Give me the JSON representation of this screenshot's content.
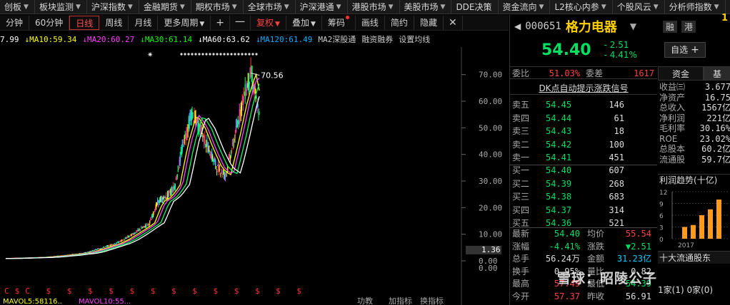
{
  "menu": [
    "创板",
    "板块监测",
    "沪深指数",
    "金融期货",
    "期权市场",
    "全球市场",
    "沪深港通",
    "港股市场",
    "美股市场",
    "DDE决策",
    "资金流向",
    "L2核心内参",
    "个股风云",
    "分析师指数"
  ],
  "toolbar": {
    "min": "分钟",
    "m60": "60分钟",
    "daily": "日线",
    "weekly": "周线",
    "monthly": "月线",
    "more": "更多周期",
    "plus": "+",
    "minus": "一",
    "fuquan": "复权",
    "overlay": "叠加",
    "chips": "筹码",
    "draw": "画线",
    "simple": "简约",
    "hide": "隐藏"
  },
  "ma_legend": [
    {
      "text": "7.99",
      "color": "#ffffff"
    },
    {
      "text": "MA10:59.34",
      "color": "#ffff00"
    },
    {
      "text": "MA20:60.27",
      "color": "#ff40ff"
    },
    {
      "text": "MA30:61.14",
      "color": "#00ff00"
    },
    {
      "text": "MA60:63.62",
      "color": "#ffffff"
    },
    {
      "text": "MA120:61.49",
      "color": "#00b0ff"
    },
    {
      "text": "MA2深股通",
      "color": "#cccccc"
    },
    {
      "text": "融资融券",
      "color": "#cccccc"
    },
    {
      "text": "设置均线",
      "color": "#cccccc"
    }
  ],
  "chart_data": {
    "type": "candlestick",
    "y_ticks": [
      "70.00",
      "60.00",
      "50.00",
      "40.00",
      "30.00",
      "20.00",
      "10.00",
      "0.00",
      "0.00"
    ],
    "ylim": [
      0,
      75
    ],
    "high_label": "70.56",
    "marker_label": "1.36",
    "signals": "C$C $ $ $ $ $ $ $ $ $ $ $ $ $",
    "bottom_labels": [
      "MAVOL5:58116..",
      "MAVOL10:55..."
    ],
    "bottom_tabs": [
      "功教",
      "加指标",
      "换指标"
    ],
    "trend": [
      0.9,
      1.0,
      1.1,
      1.2,
      1.3,
      1.5,
      1.8,
      2.1,
      2.5,
      2.8,
      3.5,
      4.5,
      5.5,
      6.5,
      8,
      10,
      12,
      14,
      22,
      24,
      28,
      44,
      55,
      50,
      42,
      35,
      32,
      45,
      60,
      70.56,
      54.4
    ]
  },
  "quote": {
    "code": "000651",
    "name": "格力电器",
    "tags": [
      "融",
      "港"
    ],
    "price": "54.40",
    "change": "- 2.51",
    "change_pct": "- 4.41%",
    "zixuan": "自选"
  },
  "weibi": {
    "label": "委比",
    "value": "51.03%",
    "label2": "委差",
    "value2": "1617"
  },
  "dk_line": "DK点自动提示涨跌信号",
  "asks": [
    {
      "label": "卖五",
      "price": "54.45",
      "vol": "146"
    },
    {
      "label": "卖四",
      "price": "54.44",
      "vol": "61"
    },
    {
      "label": "卖三",
      "price": "54.43",
      "vol": "18"
    },
    {
      "label": "卖二",
      "price": "54.42",
      "vol": "100"
    },
    {
      "label": "卖一",
      "price": "54.41",
      "vol": "451"
    }
  ],
  "bids": [
    {
      "label": "买一",
      "price": "54.40",
      "vol": "607"
    },
    {
      "label": "买二",
      "price": "54.39",
      "vol": "268"
    },
    {
      "label": "买三",
      "price": "54.38",
      "vol": "683"
    },
    {
      "label": "买四",
      "price": "54.37",
      "vol": "314"
    },
    {
      "label": "买五",
      "price": "54.36",
      "vol": "521"
    }
  ],
  "stats": [
    {
      "k": "最新",
      "v": "54.40",
      "vc": "#00e060",
      "k2": "均价",
      "v2": "55.54",
      "v2c": "#ff4040"
    },
    {
      "k": "涨幅",
      "v": "-4.41%",
      "vc": "#00e060",
      "k2": "涨跌",
      "v2": "▼2.51",
      "v2c": "#00e060"
    },
    {
      "k": "总手",
      "v": "56.24万",
      "vc": "#ddd",
      "k2": "金额",
      "v2": "31.23亿",
      "v2c": "#00d0ff"
    },
    {
      "k": "换手",
      "v": "0.95%",
      "vc": "#ddd",
      "k2": "量比",
      "v2": "0.82",
      "v2c": "#ddd"
    },
    {
      "k": "最高",
      "v": "57.49",
      "vc": "#ff4040",
      "k2": "最低",
      "v2": "54.39",
      "v2c": "#00e060"
    },
    {
      "k": "今开",
      "v": "57.37",
      "vc": "#ff4040",
      "k2": "昨收",
      "v2": "56.91",
      "v2c": "#ddd"
    }
  ],
  "fin_tabs": [
    "资金",
    "基"
  ],
  "fin": [
    {
      "k": "收益㈢",
      "v": "3.677"
    },
    {
      "k": "净资产",
      "v": "16.75"
    },
    {
      "k": "总收入",
      "v": "1567亿"
    },
    {
      "k": "净利润",
      "v": "221亿"
    },
    {
      "k": "毛利率",
      "v": "30.16%"
    },
    {
      "k": "ROE",
      "v": "23.02%"
    },
    {
      "k": "总股本",
      "v": "60.2亿"
    },
    {
      "k": "流通股",
      "v": "59.7亿"
    }
  ],
  "trend_title": "利润趋势(十亿)",
  "mini_chart": {
    "y_ticks": [
      "12",
      "9",
      "6",
      "3",
      "0"
    ],
    "x_label": "2017",
    "values": [
      3,
      3.5,
      6,
      7.5,
      10
    ]
  },
  "top10_title": "十大流通股东",
  "bottom_info": "1家(1)  0家(0)",
  "watermark": "雪球：昭陵公子",
  "corner": "1"
}
